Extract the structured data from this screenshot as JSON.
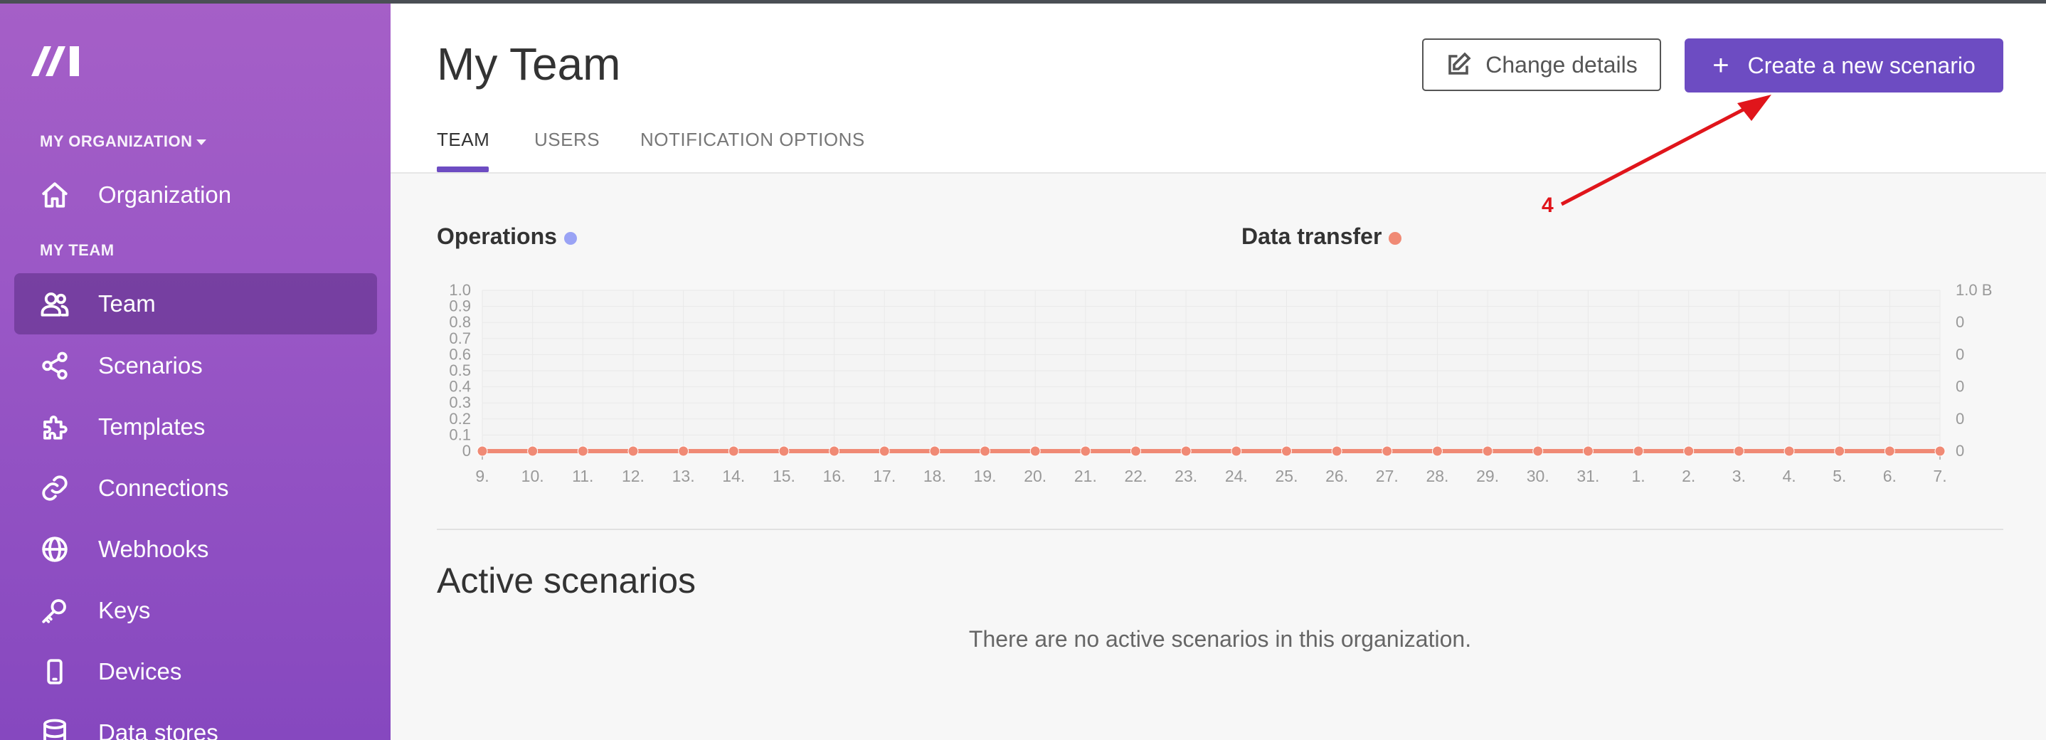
{
  "sidebar": {
    "org_label": "MY ORGANIZATION",
    "team_label": "MY TEAM",
    "items": [
      {
        "label": "Organization",
        "icon": "home-icon"
      },
      {
        "label": "Team",
        "icon": "users-icon"
      },
      {
        "label": "Scenarios",
        "icon": "share-icon"
      },
      {
        "label": "Templates",
        "icon": "puzzle-icon"
      },
      {
        "label": "Connections",
        "icon": "link-icon"
      },
      {
        "label": "Webhooks",
        "icon": "globe-icon"
      },
      {
        "label": "Keys",
        "icon": "key-icon"
      },
      {
        "label": "Devices",
        "icon": "mobile-icon"
      },
      {
        "label": "Data stores",
        "icon": "database-icon"
      }
    ]
  },
  "header": {
    "title": "My Team",
    "tabs": [
      "TEAM",
      "USERS",
      "NOTIFICATION OPTIONS"
    ],
    "change_details_label": "Change details",
    "create_label": "Create a new scenario"
  },
  "annotation": {
    "label": "4"
  },
  "colors": {
    "accent": "#6d4cc2",
    "operations": "#9aa3f5",
    "data_transfer": "#f08a75",
    "annotation": "#e0151b"
  },
  "chart_data": {
    "type": "line",
    "legend": [
      "Operations",
      "Data transfer"
    ],
    "categories": [
      "9.",
      "10.",
      "11.",
      "12.",
      "13.",
      "14.",
      "15.",
      "16.",
      "17.",
      "18.",
      "19.",
      "20.",
      "21.",
      "22.",
      "23.",
      "24.",
      "25.",
      "26.",
      "27.",
      "28.",
      "29.",
      "30.",
      "31.",
      "1.",
      "2.",
      "3.",
      "4.",
      "5.",
      "6.",
      "7."
    ],
    "left_ticks": [
      "0",
      "0.1",
      "0.2",
      "0.3",
      "0.4",
      "0.5",
      "0.6",
      "0.7",
      "0.8",
      "0.9",
      "1.0"
    ],
    "right_ticks": [
      "0",
      "0",
      "0",
      "0",
      "0",
      "1.0 B"
    ],
    "ylim": [
      0,
      1
    ],
    "series": [
      {
        "name": "Operations",
        "values": [
          0,
          0,
          0,
          0,
          0,
          0,
          0,
          0,
          0,
          0,
          0,
          0,
          0,
          0,
          0,
          0,
          0,
          0,
          0,
          0,
          0,
          0,
          0,
          0,
          0,
          0,
          0,
          0,
          0,
          0
        ]
      },
      {
        "name": "Data transfer",
        "values": [
          0,
          0,
          0,
          0,
          0,
          0,
          0,
          0,
          0,
          0,
          0,
          0,
          0,
          0,
          0,
          0,
          0,
          0,
          0,
          0,
          0,
          0,
          0,
          0,
          0,
          0,
          0,
          0,
          0,
          0
        ]
      }
    ],
    "grid": true
  },
  "active_scenarios": {
    "title": "Active scenarios",
    "empty_message": "There are no active scenarios in this organization."
  }
}
